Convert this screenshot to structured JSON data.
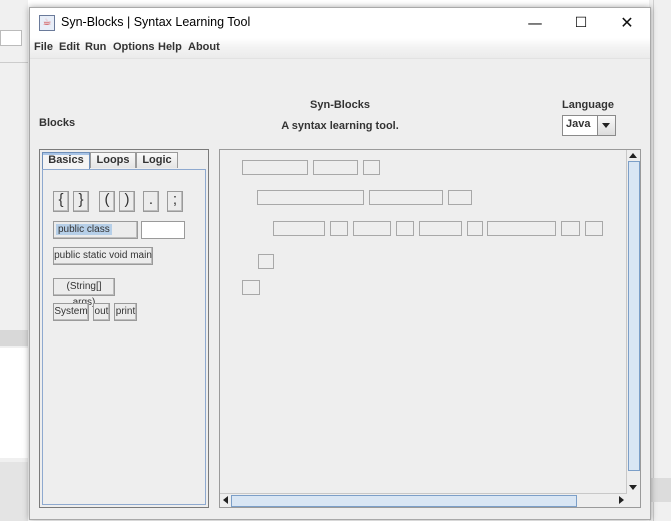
{
  "window": {
    "title": "Syn-Blocks | Syntax Learning Tool",
    "controls": {
      "minimize": "—",
      "maximize": "☐",
      "close": "✕"
    }
  },
  "menu": [
    "File",
    "Edit",
    "Run",
    "Options",
    "Help",
    "About"
  ],
  "header": {
    "blocks_label": "Blocks",
    "heading": "Syn-Blocks",
    "subheading": "A syntax learning tool.",
    "language_label": "Language",
    "language_value": "Java"
  },
  "palette": {
    "tabs": [
      "Basics",
      "Loops",
      "Logic"
    ],
    "active_tab": "Basics",
    "symbols": [
      "{",
      "}",
      "(",
      ")",
      ".",
      ";"
    ],
    "blocks": {
      "public_class": "public class",
      "main_method": "public static void main",
      "args": "(String[] args)",
      "system": "System",
      "out": "out",
      "print": "print"
    }
  },
  "icons": {
    "app": "java-cup-icon",
    "scroll_up": "arrow-up-icon",
    "scroll_down": "arrow-down-icon",
    "scroll_left": "arrow-left-icon",
    "scroll_right": "arrow-right-icon"
  }
}
